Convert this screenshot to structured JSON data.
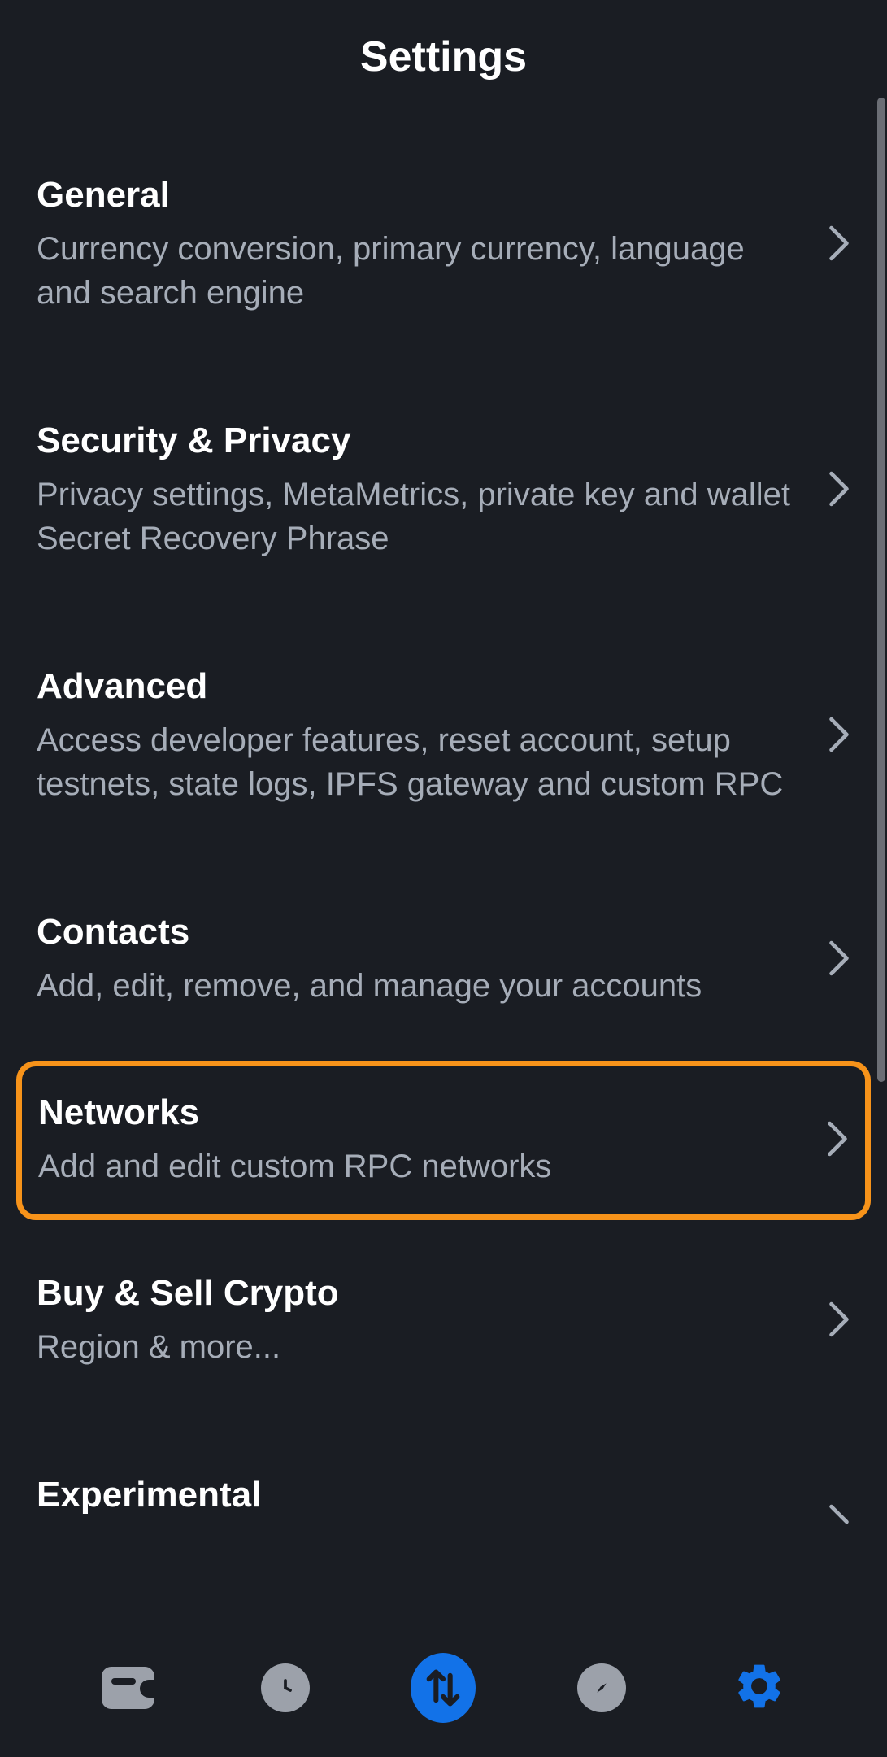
{
  "header": {
    "title": "Settings"
  },
  "items": [
    {
      "title": "General",
      "desc": "Currency conversion, primary currency, language and search engine",
      "highlighted": false
    },
    {
      "title": "Security & Privacy",
      "desc": "Privacy settings, MetaMetrics, private key and wallet Secret Recovery Phrase",
      "highlighted": false
    },
    {
      "title": "Advanced",
      "desc": "Access developer features, reset account, setup testnets, state logs, IPFS gateway and custom RPC",
      "highlighted": false
    },
    {
      "title": "Contacts",
      "desc": "Add, edit, remove, and manage your accounts",
      "highlighted": false
    },
    {
      "title": "Networks",
      "desc": "Add and edit custom RPC networks",
      "highlighted": true
    },
    {
      "title": "Buy & Sell Crypto",
      "desc": "Region & more...",
      "highlighted": false
    },
    {
      "title": "Experimental",
      "desc": "",
      "highlighted": false
    }
  ]
}
